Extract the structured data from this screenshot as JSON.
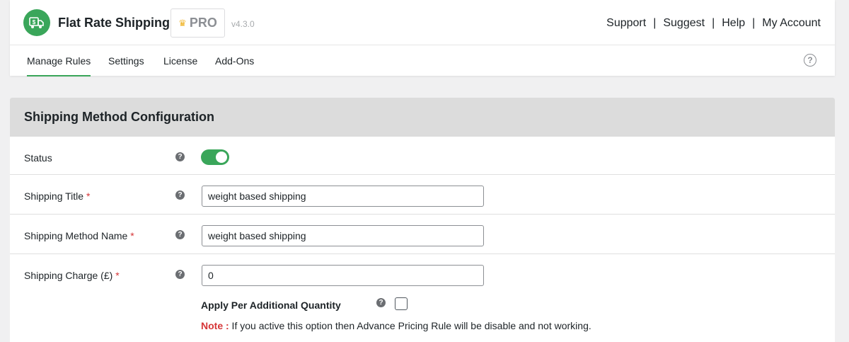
{
  "app": {
    "title": "Flat Rate Shipping",
    "pro_label": "PRO",
    "version": "v4.3.0",
    "brand_color": "#3aa65a"
  },
  "top_links": [
    "Support",
    "Suggest",
    "Help",
    "My Account"
  ],
  "tabs": [
    {
      "label": "Manage Rules",
      "active": true
    },
    {
      "label": "Settings",
      "active": false
    },
    {
      "label": "License",
      "active": false
    },
    {
      "label": "Add-Ons",
      "active": false
    }
  ],
  "panel": {
    "title": "Shipping Method Configuration",
    "status": {
      "label": "Status",
      "enabled": true
    },
    "shipping_title": {
      "label": "Shipping Title",
      "required_mark": "*",
      "value": "weight based shipping"
    },
    "method_name": {
      "label": "Shipping Method Name",
      "required_mark": "*",
      "value": "weight based shipping"
    },
    "charge": {
      "label": "Shipping Charge (£)",
      "required_mark": "*",
      "value": "0"
    },
    "apply_per_qty": {
      "label": "Apply Per Additional Quantity",
      "checked": false
    },
    "note": {
      "label": "Note :",
      "text": " If you active this option then Advance Pricing Rule will be disable and not working."
    }
  },
  "icons": {
    "logo": "shipping-truck-icon",
    "crown": "crown-icon",
    "help": "question-circle-icon",
    "field_help": "question-mark-icon"
  }
}
